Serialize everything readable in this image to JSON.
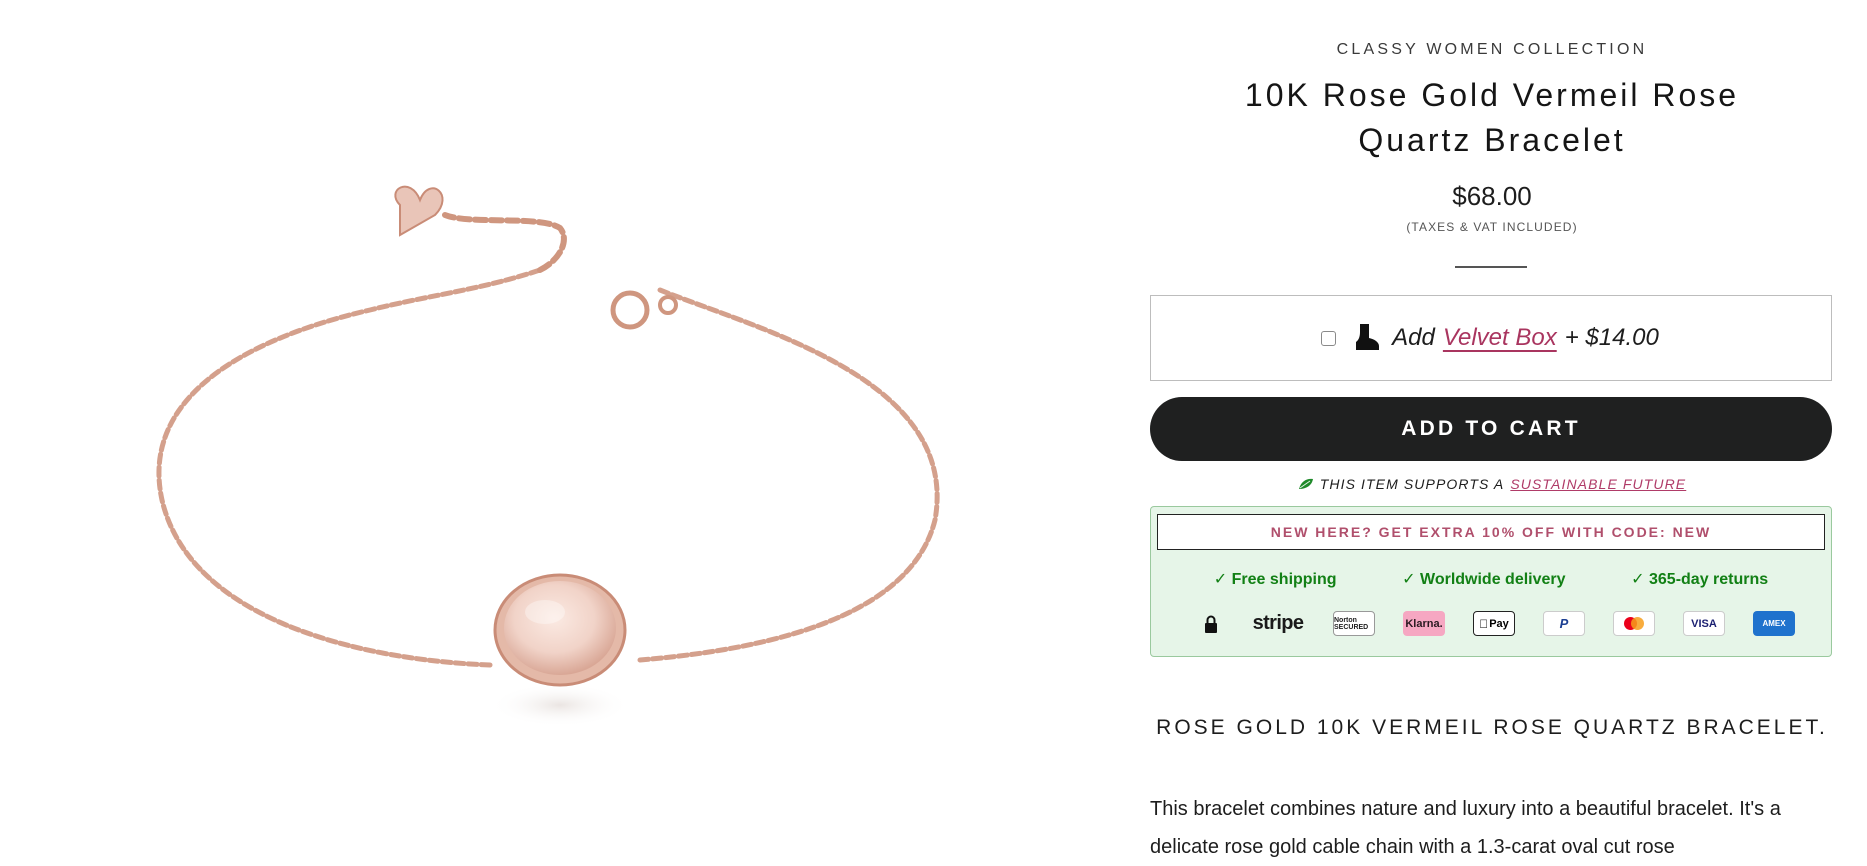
{
  "product": {
    "collection": "CLASSY WOMEN COLLECTION",
    "title": "10K Rose Gold Vermeil Rose Quartz Bracelet",
    "price": "$68.00",
    "tax_note": "(TAXES & VAT INCLUDED)",
    "image_alt": "Rose gold cable chain bracelet with oval rose quartz stone"
  },
  "addon": {
    "prefix": "Add",
    "link": "Velvet Box",
    "price": "+ $14.00",
    "checked": false,
    "icon": "boot-icon"
  },
  "cart": {
    "label": "ADD TO CART"
  },
  "sustain": {
    "text": "THIS ITEM SUPPORTS A",
    "link": "SUSTAINABLE FUTURE",
    "icon": "leaf-icon"
  },
  "trust": {
    "promo": "NEW HERE? GET EXTRA 10% OFF WITH CODE: NEW",
    "perks": [
      "✓ Free shipping",
      "✓ Worldwide delivery",
      "✓ 365-day returns"
    ],
    "payments": {
      "stripe": "stripe",
      "norton": "Norton SECURED",
      "klarna": "Klarna.",
      "apple": "Pay",
      "paypal": "P",
      "visa": "VISA",
      "amex": "AMEX"
    }
  },
  "description": {
    "heading": "ROSE GOLD 10K VERMEIL ROSE QUARTZ BRACELET.",
    "text": "This bracelet combines nature and luxury into a beautiful bracelet. It's a delicate rose gold cable chain with a 1.3-carat oval cut rose"
  },
  "colors": {
    "accent_pink": "#a9355f",
    "button_dark": "#1f2020",
    "trust_green": "#128015",
    "trust_bg": "#e6f5e8"
  }
}
